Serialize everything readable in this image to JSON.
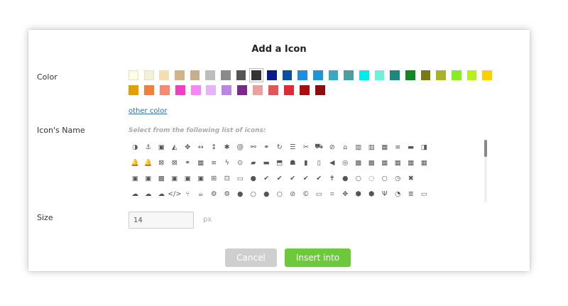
{
  "dialog": {
    "title": "Add a Icon",
    "color_label": "Color",
    "icon_name_label": "Icon's Name",
    "size_label": "Size",
    "other_color_link": "other color",
    "icons_hint": "Select from the following list of icons:",
    "size_value": "14",
    "size_unit": "px",
    "cancel_label": "Cancel",
    "insert_label": "Insert into"
  },
  "colors": {
    "row1": [
      "#fdfde4",
      "#f6f0d6",
      "#f5deb3",
      "#d2b48c",
      "#c8ad8e",
      "#bdbdbd",
      "#8a8a8a",
      "#555555",
      "#333333",
      "#0a1a8c",
      "#0b4fa0",
      "#1e8ee0",
      "#1a99d6",
      "#3aaac0",
      "#4aa0a0",
      "#00ecec",
      "#6ff0d8",
      "#1a8a80",
      "#118822",
      "#7a7a10",
      "#a8b428",
      "#88ee22",
      "#b6f020",
      "#ffd000"
    ],
    "row2": [
      "#e0a000",
      "#f08040",
      "#fa8870",
      "#f040c0",
      "#f488f4",
      "#e4b4f4",
      "#b888e0",
      "#7a2a8a",
      "#e8a0a0",
      "#e05858",
      "#e02a3a",
      "#a81010",
      "#881010"
    ],
    "selected": "#333333"
  },
  "icons": {
    "row1": [
      "◑",
      "⚓",
      "▣",
      "◭",
      "✥",
      "↔",
      "↕",
      "✱",
      "@",
      "⚯",
      "⚭",
      "↻",
      "☰",
      "✂",
      "⛟",
      "⊘",
      "⌂",
      "▥",
      "▥",
      "▦",
      "≡",
      "▬",
      "◨"
    ],
    "row2": [
      "🔔",
      "🔔",
      "⊠",
      "⊠",
      "⚭",
      "▦",
      "≡",
      "ϟ",
      "⊙",
      "▰",
      "▬",
      "⬒",
      "☗",
      "▮",
      "▯",
      "◀",
      "◎",
      "▩",
      "▩",
      "▦",
      "▦",
      "▦",
      "▦"
    ],
    "row3": [
      "▣",
      "▣",
      "▩",
      "▣",
      "▣",
      "▣",
      "⊞",
      "⊡",
      "▭",
      "●",
      "✔",
      "✔",
      "✔",
      "✔",
      "✔",
      "✝",
      "●",
      "○",
      "◌",
      "○",
      "◷",
      "✖"
    ],
    "row4": [
      "☁",
      "☁",
      "☁",
      "</>",
      "⑂",
      "☕",
      "⚙",
      "⚙",
      "●",
      "○",
      "●",
      "○",
      "⊘",
      "©",
      "▭",
      "⌗",
      "✥",
      "⬢",
      "⬢",
      "Ψ",
      "◔",
      "≣",
      "▭"
    ]
  }
}
